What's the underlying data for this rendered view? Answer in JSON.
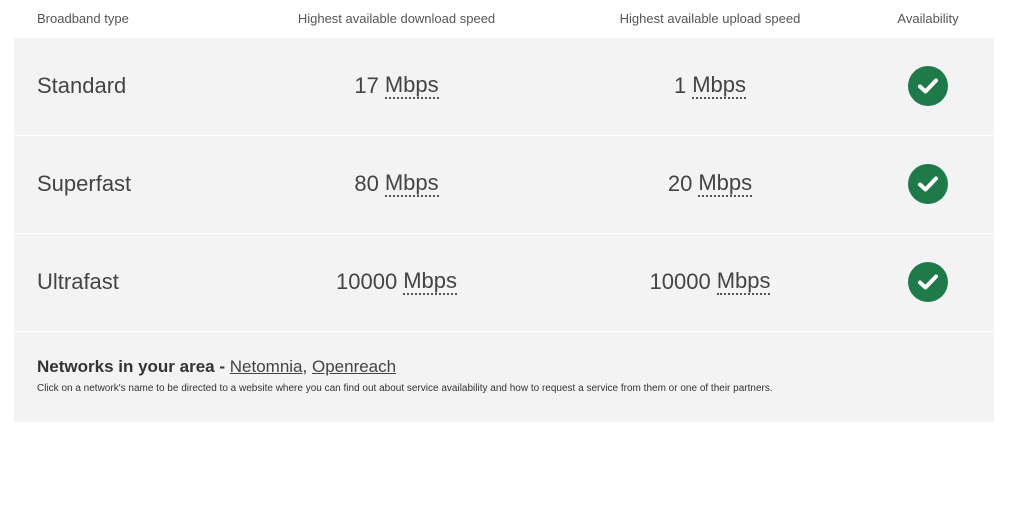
{
  "header": {
    "type": "Broadband type",
    "download": "Highest available download speed",
    "upload": "Highest available upload speed",
    "availability": "Availability"
  },
  "rows": [
    {
      "type": "Standard",
      "download_value": "17",
      "download_unit": "Mbps",
      "upload_value": "1",
      "upload_unit": "Mbps",
      "available": true,
      "icon": "check-circle-icon"
    },
    {
      "type": "Superfast",
      "download_value": "80",
      "download_unit": "Mbps",
      "upload_value": "20",
      "upload_unit": "Mbps",
      "available": true,
      "icon": "check-circle-icon"
    },
    {
      "type": "Ultrafast",
      "download_value": "10000",
      "download_unit": "Mbps",
      "upload_value": "10000",
      "upload_unit": "Mbps",
      "available": true,
      "icon": "check-circle-icon"
    }
  ],
  "footer": {
    "title_prefix": "Networks in your area -",
    "networks": [
      "Netomnia",
      "Openreach"
    ],
    "separator": ",",
    "note": "Click on a network's name to be directed to a website where you can find out about service availability and how to request a service from them or one of their partners."
  },
  "colors": {
    "available": "#1f7a4a",
    "row_background": "#f3f3f3"
  }
}
